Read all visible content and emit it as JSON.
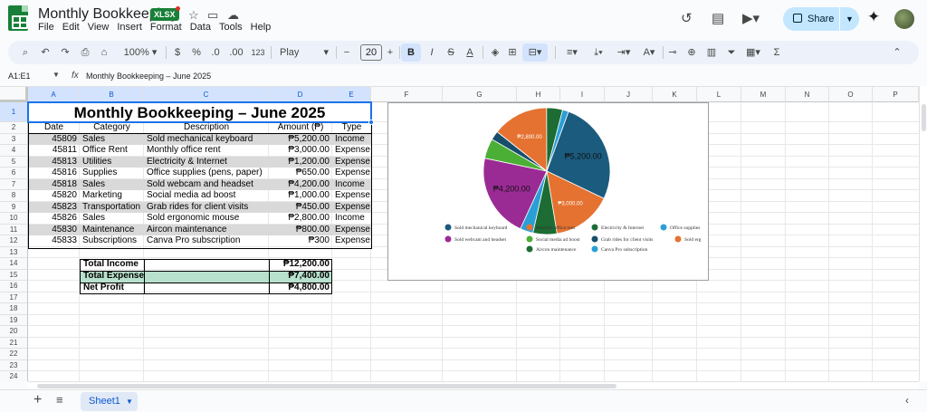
{
  "header": {
    "doc_title": "Monthly Bookkeeping",
    "file_badge": "XLSX",
    "menu": [
      "File",
      "Edit",
      "View",
      "Insert",
      "Format",
      "Data",
      "Tools",
      "Help"
    ],
    "share_label": "Share"
  },
  "toolbar": {
    "zoom": "100%",
    "currency": "$",
    "percent": "%",
    "decimal_less": ".0",
    "decimal_more": ".00",
    "number_format": "123",
    "font": "Play",
    "font_size": "20",
    "bold": "B",
    "italic": "I",
    "strike": "S",
    "text_color": "A",
    "sum": "Σ"
  },
  "formula_bar": {
    "name_box": "A1:E1",
    "fx": "fx",
    "content": "Monthly Bookkeeping – June 2025"
  },
  "grid": {
    "columns": [
      "A",
      "B",
      "C",
      "D",
      "E",
      "F",
      "G",
      "H",
      "I",
      "J",
      "K",
      "L",
      "M",
      "N",
      "O",
      "P"
    ],
    "rows": [
      "1",
      "2",
      "3",
      "4",
      "5",
      "6",
      "7",
      "8",
      "9",
      "10",
      "11",
      "12",
      "13",
      "14",
      "15",
      "16",
      "17",
      "18",
      "19",
      "20",
      "21",
      "22",
      "23",
      "24"
    ]
  },
  "sheet": {
    "title": "Monthly Bookkeeping – June 2025",
    "headers": [
      "Date",
      "Category",
      "Description",
      "Amount (₱)",
      "Type"
    ],
    "rows": [
      [
        "45809",
        "Sales",
        "Sold mechanical keyboard",
        "₱5,200.00",
        "Income"
      ],
      [
        "45811",
        "Office Rent",
        "Monthly office rent",
        "₱3,000.00",
        "Expense"
      ],
      [
        "45813",
        "Utilities",
        "Electricity & Internet",
        "₱1,200.00",
        "Expense"
      ],
      [
        "45816",
        "Supplies",
        "Office supplies (pens, paper)",
        "₱650.00",
        "Expense"
      ],
      [
        "45818",
        "Sales",
        "Sold webcam and headset",
        "₱4,200.00",
        "Income"
      ],
      [
        "45820",
        "Marketing",
        "Social media ad boost",
        "₱1,000.00",
        "Expense"
      ],
      [
        "45823",
        "Transportation",
        "Grab rides for client visits",
        "₱450.00",
        "Expense"
      ],
      [
        "45826",
        "Sales",
        "Sold ergonomic mouse",
        "₱2,800.00",
        "Income"
      ],
      [
        "45830",
        "Maintenance",
        "Aircon maintenance",
        "₱800.00",
        "Expense"
      ],
      [
        "45833",
        "Subscriptions",
        "Canva Pro subscription",
        "₱300",
        "Expense"
      ]
    ],
    "summary": [
      [
        "Total Income",
        "₱12,200.00"
      ],
      [
        "Total Expense",
        "₱7,400.00"
      ],
      [
        "Net Profit",
        "₱4,800.00"
      ]
    ]
  },
  "chart_data": {
    "type": "pie",
    "categories": [
      "Sold mechanical keyboard",
      "Monthly office rent",
      "Electricity & Internet",
      "Office supplies (pens, paper)",
      "Sold webcam and headset",
      "Social media ad boost",
      "Grab rides for client visits",
      "Sold ergonomic mouse",
      "Aircon maintenance",
      "Canva Pro subscription"
    ],
    "values": [
      5200,
      3000,
      1200,
      650,
      4200,
      1000,
      450,
      2800,
      800,
      300
    ],
    "colors": [
      "#1b5b7e",
      "#e57230",
      "#1c6c34",
      "#2a9fd6",
      "#9b2b94",
      "#4caf35",
      "#174e6b",
      "#e57230",
      "#1c6c34",
      "#2a9fd6"
    ],
    "data_labels": [
      "₱5,200.00",
      "₱3,000.00",
      "",
      "",
      "₱4,200.00",
      "",
      "",
      "₱2,800.00",
      "",
      ""
    ],
    "legend_labels": [
      "Sold mechanical keyboard",
      "Monthly office rent",
      "Electricity & Internet",
      "Office supplies",
      "Sold webcam and headset",
      "Social media ad boost",
      "Grab rides for client visits",
      "Sold erg",
      "Aircon maintenance",
      "Canva Pro subscription"
    ],
    "legend_position": "bottom"
  },
  "bottom": {
    "sheet_tab": "Sheet1"
  }
}
